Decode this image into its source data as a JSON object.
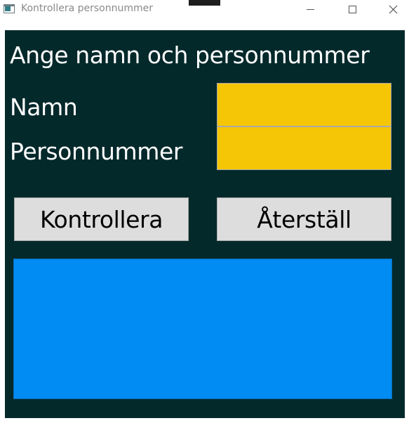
{
  "window": {
    "title": "Kontrollera personnummer"
  },
  "form": {
    "heading": "Ange namn och personnummer",
    "name_label": "Namn",
    "name_value": "",
    "pnr_label": "Personnummer",
    "pnr_value": ""
  },
  "buttons": {
    "check_label": "Kontrollera",
    "reset_label": "Återställ"
  },
  "output": {
    "text": ""
  },
  "colors": {
    "background": "#04292b",
    "input_fill": "#f5c605",
    "output_fill": "#008cf3",
    "button_fill": "#dddddd"
  },
  "icons": {
    "app": "app-window-icon",
    "minimize": "minimize-icon",
    "maximize": "maximize-icon",
    "close": "close-icon"
  }
}
